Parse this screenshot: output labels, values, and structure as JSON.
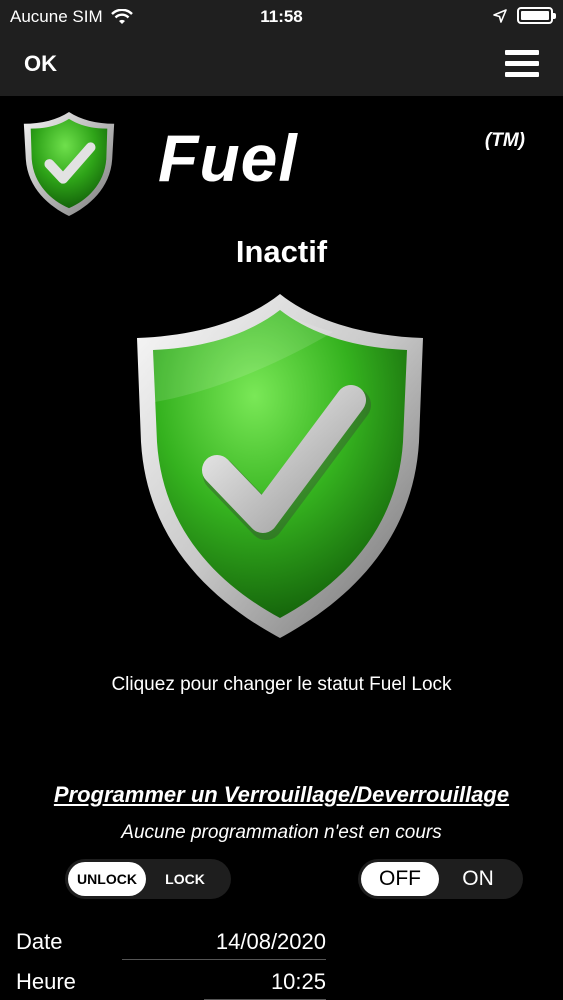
{
  "status_bar": {
    "carrier": "Aucune SIM",
    "time": "11:58"
  },
  "nav": {
    "ok_label": "OK"
  },
  "header": {
    "title": "Fuel",
    "trademark": "(TM)"
  },
  "status": {
    "label": "Inactif",
    "hint": "Cliquez pour changer le statut Fuel Lock"
  },
  "schedule": {
    "title": "Programmer un Verrouillage/Deverrouillage",
    "status_text": "Aucune programmation n'est en cours",
    "mode_options": [
      "UNLOCK",
      "LOCK"
    ],
    "mode_selected": "UNLOCK",
    "toggle_options": [
      "OFF",
      "ON"
    ],
    "toggle_selected": "OFF",
    "date_label": "Date",
    "date_value": "14/08/2020",
    "time_label": "Heure",
    "time_value": "10:25"
  },
  "colors": {
    "shield_green": "#35b21f",
    "check_silver": "#d9d9d9",
    "background": "#000000",
    "bar": "#1f1f1f"
  },
  "icons": {
    "wifi": "wifi-icon",
    "location": "location-arrow-icon",
    "battery": "battery-icon",
    "menu": "hamburger-menu-icon",
    "shield": "shield-check-icon"
  }
}
